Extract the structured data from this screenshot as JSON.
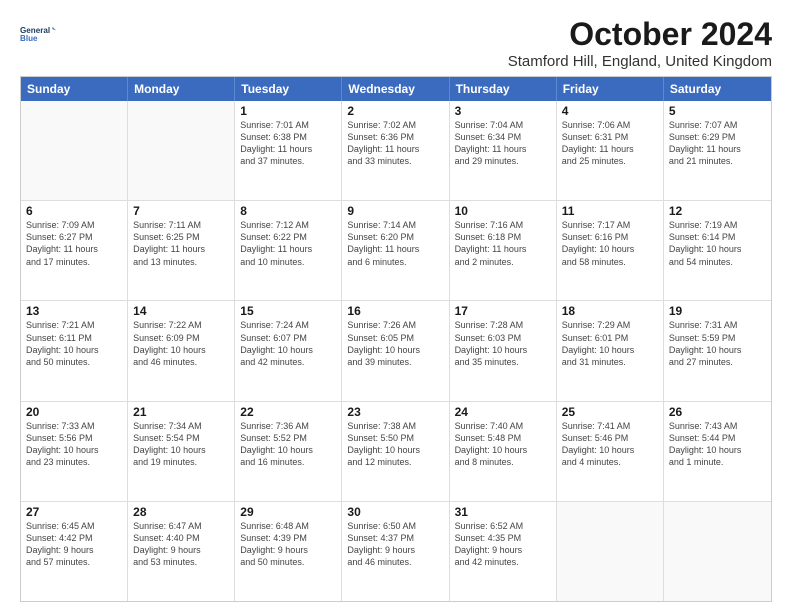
{
  "logo": {
    "line1": "General",
    "line2": "Blue"
  },
  "title": "October 2024",
  "subtitle": "Stamford Hill, England, United Kingdom",
  "header_days": [
    "Sunday",
    "Monday",
    "Tuesday",
    "Wednesday",
    "Thursday",
    "Friday",
    "Saturday"
  ],
  "weeks": [
    [
      {
        "date": "",
        "info": ""
      },
      {
        "date": "",
        "info": ""
      },
      {
        "date": "1",
        "info": "Sunrise: 7:01 AM\nSunset: 6:38 PM\nDaylight: 11 hours\nand 37 minutes."
      },
      {
        "date": "2",
        "info": "Sunrise: 7:02 AM\nSunset: 6:36 PM\nDaylight: 11 hours\nand 33 minutes."
      },
      {
        "date": "3",
        "info": "Sunrise: 7:04 AM\nSunset: 6:34 PM\nDaylight: 11 hours\nand 29 minutes."
      },
      {
        "date": "4",
        "info": "Sunrise: 7:06 AM\nSunset: 6:31 PM\nDaylight: 11 hours\nand 25 minutes."
      },
      {
        "date": "5",
        "info": "Sunrise: 7:07 AM\nSunset: 6:29 PM\nDaylight: 11 hours\nand 21 minutes."
      }
    ],
    [
      {
        "date": "6",
        "info": "Sunrise: 7:09 AM\nSunset: 6:27 PM\nDaylight: 11 hours\nand 17 minutes."
      },
      {
        "date": "7",
        "info": "Sunrise: 7:11 AM\nSunset: 6:25 PM\nDaylight: 11 hours\nand 13 minutes."
      },
      {
        "date": "8",
        "info": "Sunrise: 7:12 AM\nSunset: 6:22 PM\nDaylight: 11 hours\nand 10 minutes."
      },
      {
        "date": "9",
        "info": "Sunrise: 7:14 AM\nSunset: 6:20 PM\nDaylight: 11 hours\nand 6 minutes."
      },
      {
        "date": "10",
        "info": "Sunrise: 7:16 AM\nSunset: 6:18 PM\nDaylight: 11 hours\nand 2 minutes."
      },
      {
        "date": "11",
        "info": "Sunrise: 7:17 AM\nSunset: 6:16 PM\nDaylight: 10 hours\nand 58 minutes."
      },
      {
        "date": "12",
        "info": "Sunrise: 7:19 AM\nSunset: 6:14 PM\nDaylight: 10 hours\nand 54 minutes."
      }
    ],
    [
      {
        "date": "13",
        "info": "Sunrise: 7:21 AM\nSunset: 6:11 PM\nDaylight: 10 hours\nand 50 minutes."
      },
      {
        "date": "14",
        "info": "Sunrise: 7:22 AM\nSunset: 6:09 PM\nDaylight: 10 hours\nand 46 minutes."
      },
      {
        "date": "15",
        "info": "Sunrise: 7:24 AM\nSunset: 6:07 PM\nDaylight: 10 hours\nand 42 minutes."
      },
      {
        "date": "16",
        "info": "Sunrise: 7:26 AM\nSunset: 6:05 PM\nDaylight: 10 hours\nand 39 minutes."
      },
      {
        "date": "17",
        "info": "Sunrise: 7:28 AM\nSunset: 6:03 PM\nDaylight: 10 hours\nand 35 minutes."
      },
      {
        "date": "18",
        "info": "Sunrise: 7:29 AM\nSunset: 6:01 PM\nDaylight: 10 hours\nand 31 minutes."
      },
      {
        "date": "19",
        "info": "Sunrise: 7:31 AM\nSunset: 5:59 PM\nDaylight: 10 hours\nand 27 minutes."
      }
    ],
    [
      {
        "date": "20",
        "info": "Sunrise: 7:33 AM\nSunset: 5:56 PM\nDaylight: 10 hours\nand 23 minutes."
      },
      {
        "date": "21",
        "info": "Sunrise: 7:34 AM\nSunset: 5:54 PM\nDaylight: 10 hours\nand 19 minutes."
      },
      {
        "date": "22",
        "info": "Sunrise: 7:36 AM\nSunset: 5:52 PM\nDaylight: 10 hours\nand 16 minutes."
      },
      {
        "date": "23",
        "info": "Sunrise: 7:38 AM\nSunset: 5:50 PM\nDaylight: 10 hours\nand 12 minutes."
      },
      {
        "date": "24",
        "info": "Sunrise: 7:40 AM\nSunset: 5:48 PM\nDaylight: 10 hours\nand 8 minutes."
      },
      {
        "date": "25",
        "info": "Sunrise: 7:41 AM\nSunset: 5:46 PM\nDaylight: 10 hours\nand 4 minutes."
      },
      {
        "date": "26",
        "info": "Sunrise: 7:43 AM\nSunset: 5:44 PM\nDaylight: 10 hours\nand 1 minute."
      }
    ],
    [
      {
        "date": "27",
        "info": "Sunrise: 6:45 AM\nSunset: 4:42 PM\nDaylight: 9 hours\nand 57 minutes."
      },
      {
        "date": "28",
        "info": "Sunrise: 6:47 AM\nSunset: 4:40 PM\nDaylight: 9 hours\nand 53 minutes."
      },
      {
        "date": "29",
        "info": "Sunrise: 6:48 AM\nSunset: 4:39 PM\nDaylight: 9 hours\nand 50 minutes."
      },
      {
        "date": "30",
        "info": "Sunrise: 6:50 AM\nSunset: 4:37 PM\nDaylight: 9 hours\nand 46 minutes."
      },
      {
        "date": "31",
        "info": "Sunrise: 6:52 AM\nSunset: 4:35 PM\nDaylight: 9 hours\nand 42 minutes."
      },
      {
        "date": "",
        "info": ""
      },
      {
        "date": "",
        "info": ""
      }
    ]
  ]
}
